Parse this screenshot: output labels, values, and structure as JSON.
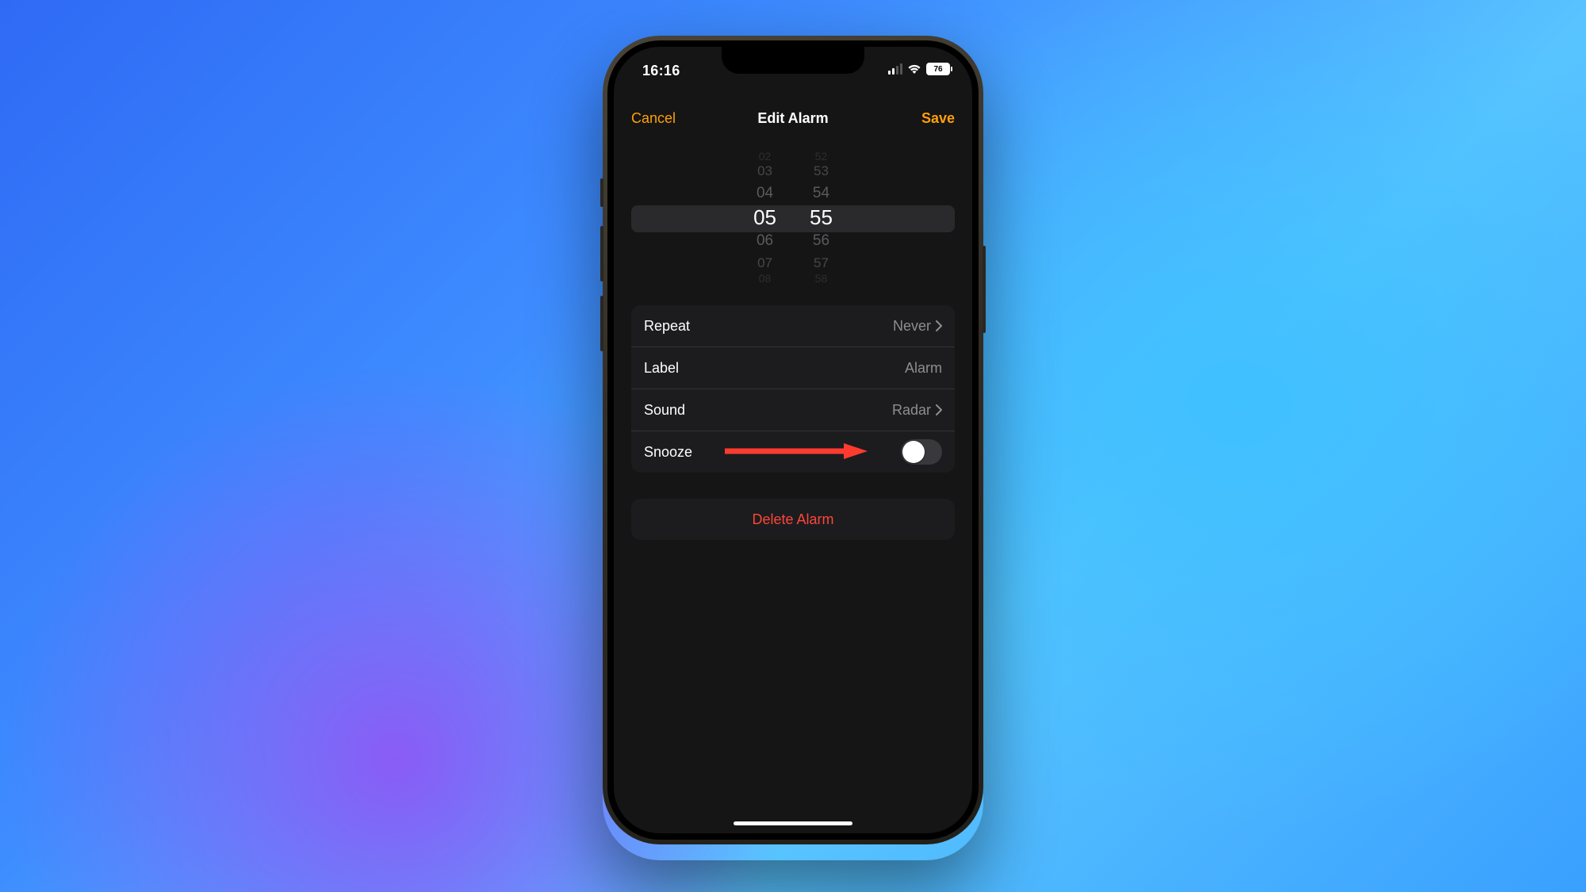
{
  "status": {
    "time": "16:16",
    "battery": "76"
  },
  "nav": {
    "cancel": "Cancel",
    "title": "Edit Alarm",
    "save": "Save"
  },
  "picker": {
    "hours": [
      "02",
      "03",
      "04",
      "05",
      "06",
      "07",
      "08"
    ],
    "minutes": [
      "52",
      "53",
      "54",
      "55",
      "56",
      "57",
      "58"
    ]
  },
  "settings": {
    "repeat_label": "Repeat",
    "repeat_value": "Never",
    "label_label": "Label",
    "label_value": "Alarm",
    "sound_label": "Sound",
    "sound_value": "Radar",
    "snooze_label": "Snooze",
    "snooze_on": false
  },
  "delete_label": "Delete Alarm",
  "colors": {
    "accent": "#ff9f0a",
    "destructive": "#ff453a",
    "annotation": "#ff3b30"
  }
}
